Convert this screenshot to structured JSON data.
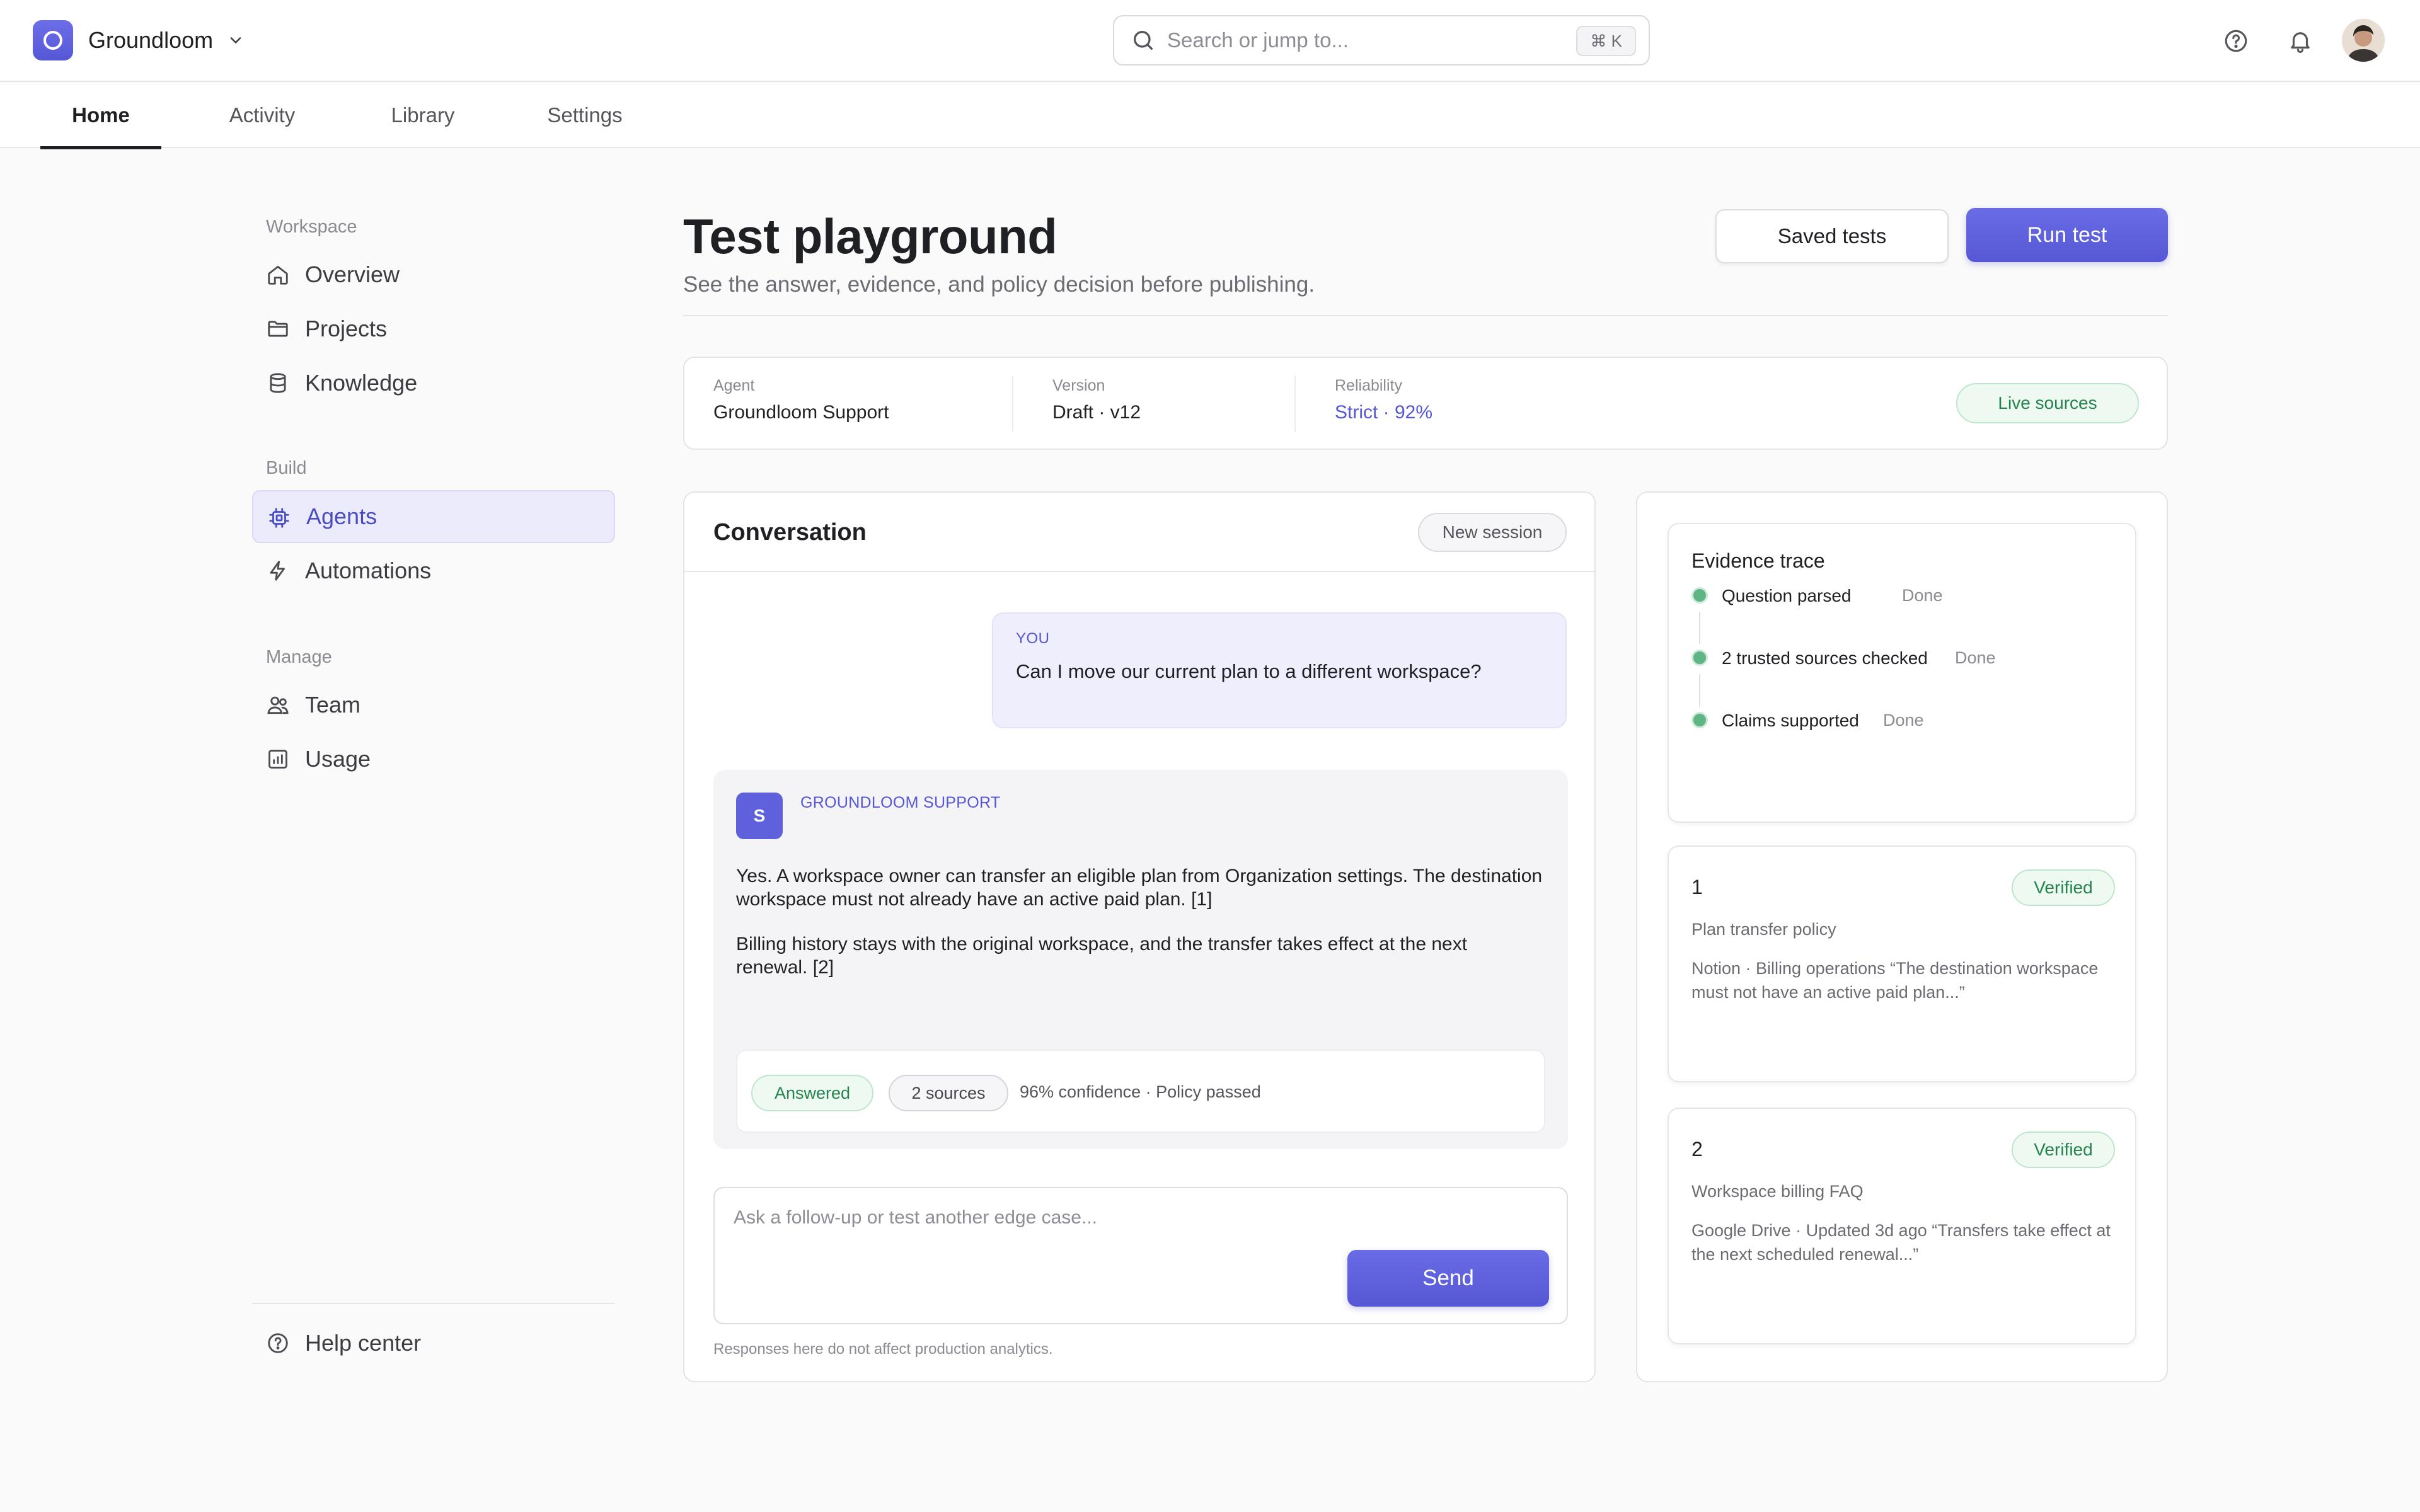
{
  "app": {
    "name": "Groundloom"
  },
  "search": {
    "placeholder": "Search or jump to...",
    "shortcut": "⌘ K"
  },
  "tabs": [
    {
      "label": "Home",
      "active": true
    },
    {
      "label": "Activity"
    },
    {
      "label": "Library"
    },
    {
      "label": "Settings"
    }
  ],
  "sidebar": {
    "sections": [
      {
        "title": "Workspace",
        "items": [
          {
            "label": "Overview",
            "icon": "home-icon"
          },
          {
            "label": "Projects",
            "icon": "folder-icon"
          },
          {
            "label": "Knowledge",
            "icon": "database-icon"
          }
        ]
      },
      {
        "title": "Build",
        "items": [
          {
            "label": "Agents",
            "icon": "chip-icon",
            "active": true
          },
          {
            "label": "Automations",
            "icon": "bolt-icon"
          }
        ]
      },
      {
        "title": "Manage",
        "items": [
          {
            "label": "Team",
            "icon": "users-icon"
          },
          {
            "label": "Usage",
            "icon": "chart-icon"
          }
        ]
      }
    ],
    "help": {
      "label": "Help center",
      "icon": "help-circle-icon"
    }
  },
  "page": {
    "title": "Test playground",
    "subtitle": "See the answer, evidence, and policy decision before publishing.",
    "saved_tests_label": "Saved tests",
    "run_test_label": "Run test"
  },
  "meta": {
    "agent_label": "Agent",
    "agent_value": "Groundloom Support",
    "version_label": "Version",
    "version_value": "Draft · v12",
    "reliability_label": "Reliability",
    "reliability_value": "Strict · 92%",
    "sources_badge": "Live sources"
  },
  "conversation": {
    "title": "Conversation",
    "new_session_label": "New session",
    "user_tag": "YOU",
    "user_message": "Can I move our current plan to a different workspace?",
    "agent_initial": "S",
    "agent_tag": "GROUNDLOOM SUPPORT",
    "agent_paragraphs": [
      "Yes. A workspace owner can transfer an eligible plan from Organization settings. The destination workspace must not already have an active paid plan. [1]",
      "Billing history stays with the original workspace, and the transfer takes effect at the next renewal. [2]"
    ],
    "status_answered": "Answered",
    "status_sources": "2 sources",
    "status_summary": "96% confidence · Policy passed",
    "composer_placeholder": "Ask a follow-up or test another edge case...",
    "send_label": "Send",
    "footnote": "Responses here do not affect production analytics."
  },
  "evidence": {
    "title": "Evidence trace",
    "steps": [
      {
        "label": "Question parsed",
        "status": "Done"
      },
      {
        "label": "2 trusted sources checked",
        "status": "Done"
      },
      {
        "label": "Claims supported",
        "status": "Done"
      }
    ],
    "sources": [
      {
        "number": "1",
        "badge": "Verified",
        "title": "Plan transfer policy",
        "quote": "Notion · Billing operations “The destination workspace must not have an active paid plan...”"
      },
      {
        "number": "2",
        "badge": "Verified",
        "title": "Workspace billing FAQ",
        "quote": "Google Drive · Updated 3d ago “Transfers take effect at the next scheduled renewal...”"
      }
    ]
  },
  "colors": {
    "accent": "#5557d4",
    "success": "#25834e",
    "success_bg": "#eef9f2"
  }
}
